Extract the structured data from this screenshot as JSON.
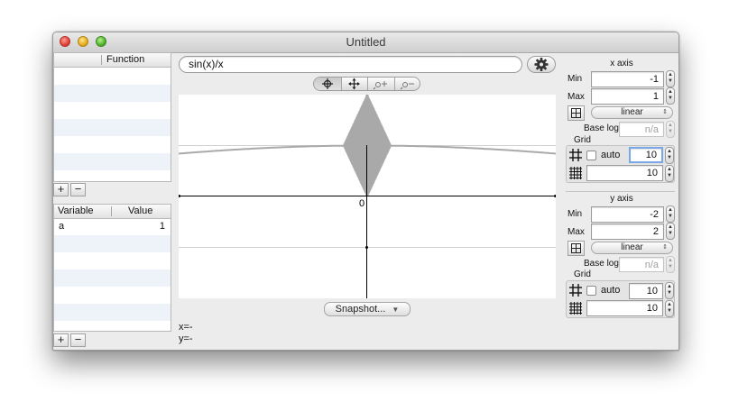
{
  "window": {
    "title": "Untitled"
  },
  "functions": {
    "column_header": "Function",
    "add_label": "+",
    "remove_label": "−"
  },
  "variables": {
    "columns": [
      "Variable",
      "Value"
    ],
    "rows": [
      {
        "name": "a",
        "value": "1"
      }
    ],
    "add_label": "+",
    "remove_label": "−"
  },
  "expression": {
    "value": "sin(x)/x"
  },
  "toolbar": {
    "modes": [
      "crosshair-icon",
      "move-icon",
      "zoom-in-icon",
      "zoom-out-icon"
    ]
  },
  "plot": {
    "origin_label": "0",
    "snapshot_label": "Snapshot...",
    "x_readout": "x=-",
    "y_readout": "y=-"
  },
  "x_axis": {
    "title": "x axis",
    "min_label": "Min",
    "min": "-1",
    "max_label": "Max",
    "max": "1",
    "scale": "linear",
    "base_label": "Base log.",
    "base_placeholder": "n/a",
    "grid_label": "Grid",
    "auto_label": "auto",
    "auto_checked": false,
    "major_div": "10",
    "minor_div": "10"
  },
  "y_axis": {
    "title": "y axis",
    "min_label": "Min",
    "min": "-2",
    "max_label": "Max",
    "max": "2",
    "scale": "linear",
    "base_label": "Base log.",
    "base_placeholder": "n/a",
    "grid_label": "Grid",
    "auto_label": "auto",
    "auto_checked": false,
    "major_div": "10",
    "minor_div": "10"
  },
  "colors": {
    "curve": "#a9a9a9",
    "axis": "#000000",
    "focus": "#7aa7e6"
  }
}
